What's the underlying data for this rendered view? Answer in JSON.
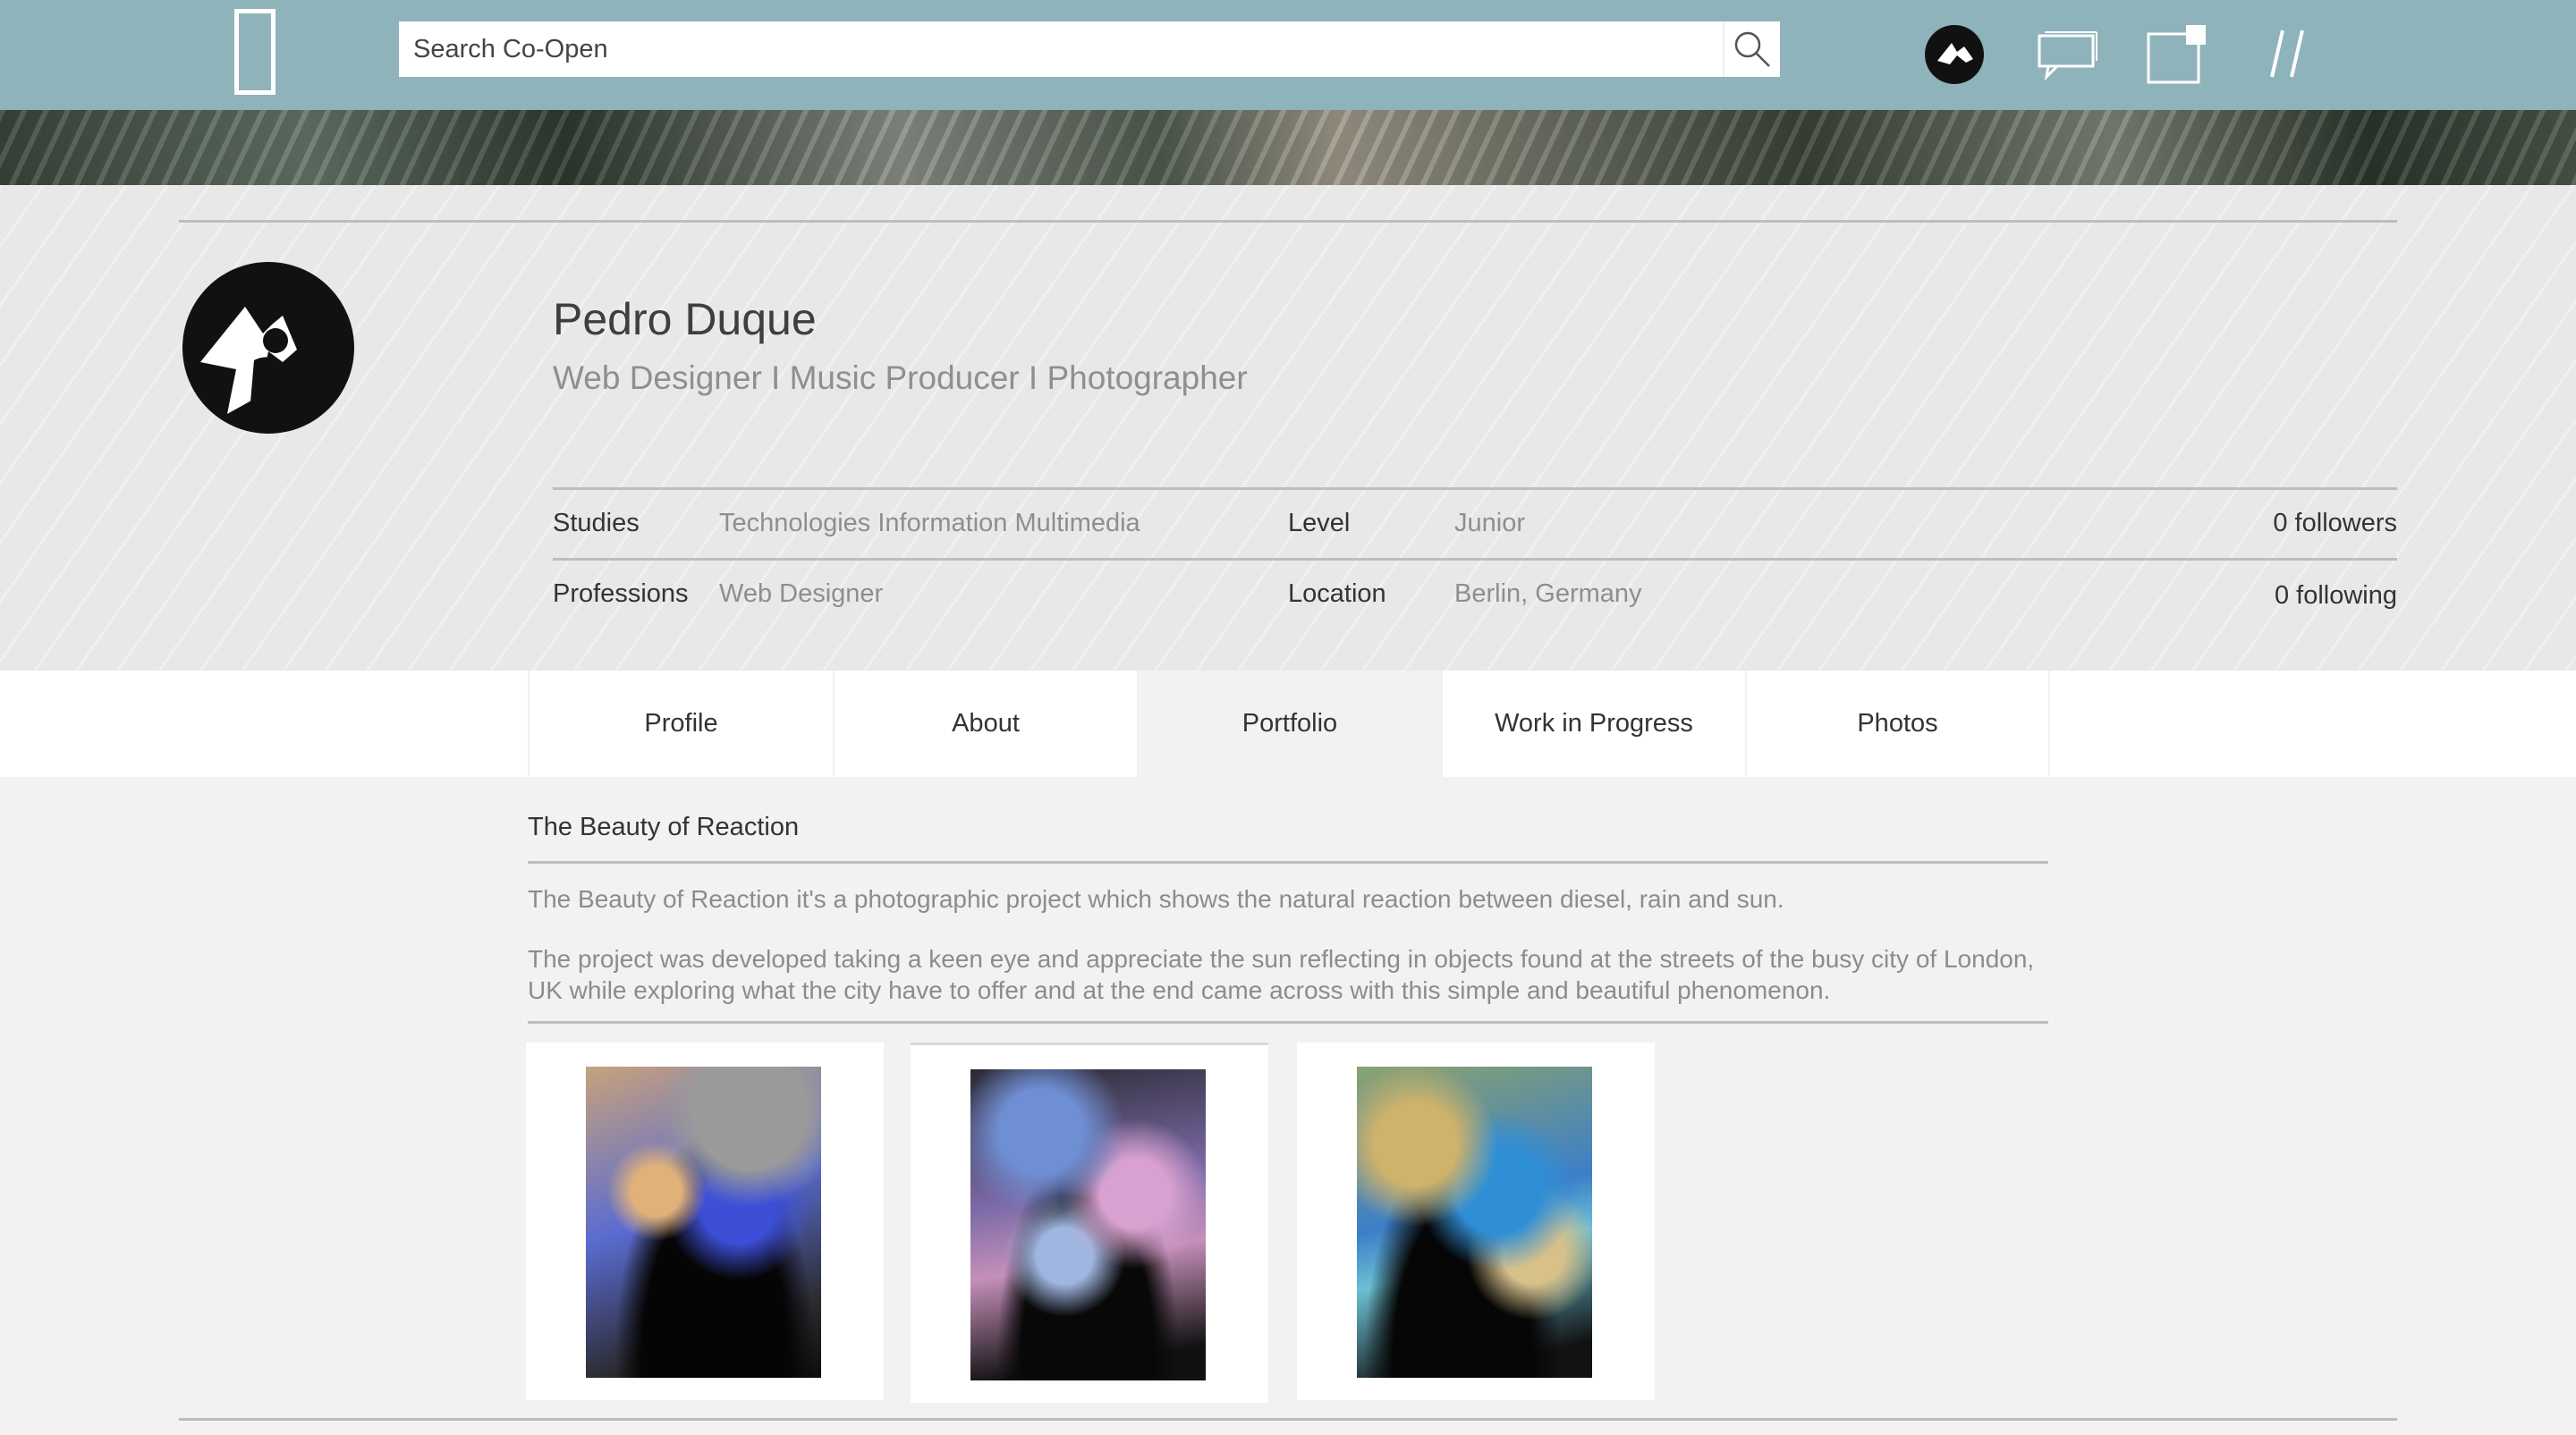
{
  "search": {
    "placeholder": "Search Co-Open"
  },
  "nav": {
    "icons": [
      "logo-icon",
      "search-icon",
      "user-avatar",
      "chat-icon",
      "notifications-icon",
      "menu-slash-icon"
    ]
  },
  "profile": {
    "name": "Pedro Duque",
    "tagline": "Web Designer I Music Producer I Photographer",
    "studies_label": "Studies",
    "studies_value": "Technologies Information Multimedia",
    "level_label": "Level",
    "level_value": "Junior",
    "professions_label": "Professions",
    "professions_value": "Web Designer",
    "location_label": "Location",
    "location_value": "Berlin, Germany",
    "followers": "0 followers",
    "following": "0 following"
  },
  "tabs": [
    {
      "label": "Profile"
    },
    {
      "label": "About"
    },
    {
      "label": "Portfolio"
    },
    {
      "label": "Work in Progress"
    },
    {
      "label": "Photos"
    }
  ],
  "active_tab": "Portfolio",
  "project": {
    "title": "The Beauty of Reaction",
    "description_1": "The Beauty of Reaction it's a photographic project which shows the natural reaction between diesel, rain and sun.",
    "description_2": "The project was developed taking a keen eye and appreciate the sun reflecting in objects found at  the streets of the busy city of London, UK while exploring what the city have to offer and at the end came across with this simple and beautiful phenomenon."
  },
  "colors": {
    "topbar": "#8fb3bb",
    "accent_text": "#8e8e8e",
    "tab_active": "#f2f2f2"
  }
}
